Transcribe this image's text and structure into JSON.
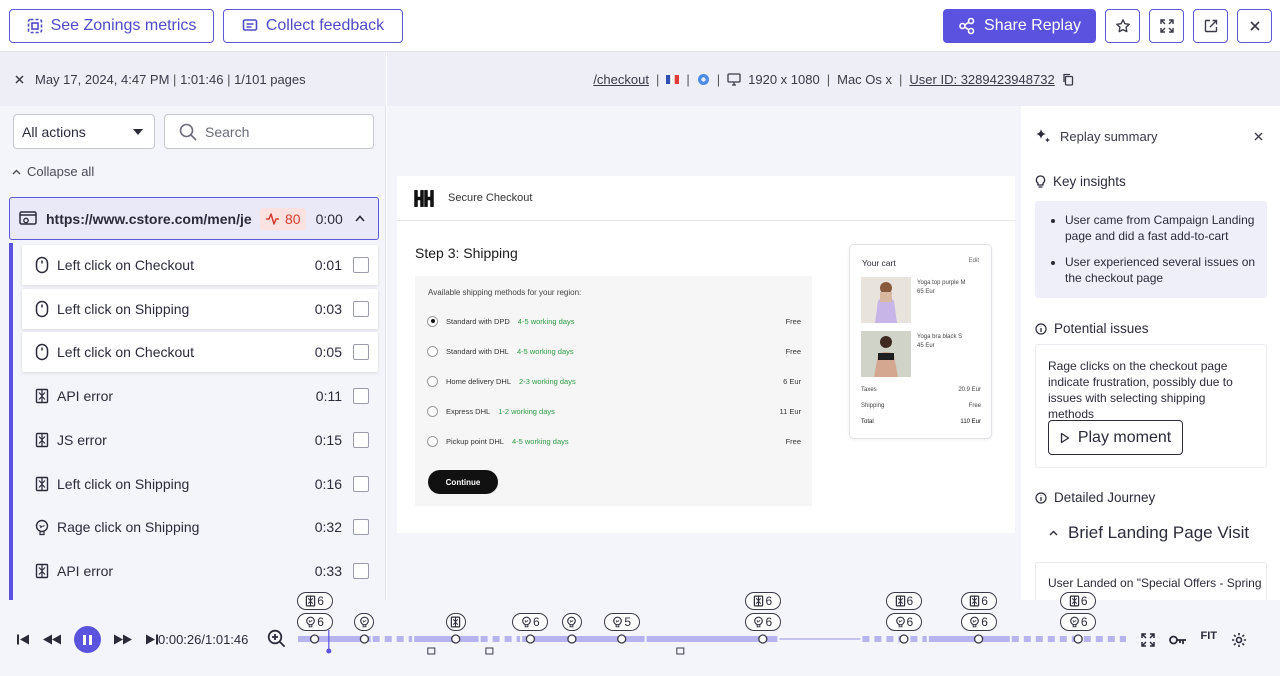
{
  "toolbar": {
    "zonings_label": "See Zonings metrics",
    "feedback_label": "Collect feedback",
    "share_label": "Share Replay"
  },
  "session": {
    "date": "May 17, 2024, 4:47 PM",
    "duration": "1:01:46",
    "pages": "1/101 pages",
    "path": "/checkout",
    "resolution": "1920 x 1080",
    "os": "Mac Os x",
    "user_id": "User ID: 3289423948732"
  },
  "filters": {
    "action_filter": "All actions",
    "search_placeholder": "Search",
    "collapse_label": "Collapse all"
  },
  "page_entry": {
    "url": "https://www.cstore.com/men/je...",
    "error_count": "80",
    "time": "0:00"
  },
  "actions": [
    {
      "icon": "mouse-icon",
      "label": "Left click on Checkout",
      "time": "0:01"
    },
    {
      "icon": "mouse-icon",
      "label": "Left click on Shipping",
      "time": "0:03"
    },
    {
      "icon": "mouse-icon",
      "label": "Left click on Checkout",
      "time": "0:05"
    },
    {
      "icon": "bug-icon",
      "label": "API error",
      "time": "0:11"
    },
    {
      "icon": "bug-icon",
      "label": "JS error",
      "time": "0:15"
    },
    {
      "icon": "bug-icon",
      "label": "Left click on Shipping",
      "time": "0:16"
    },
    {
      "icon": "rage-click-icon",
      "label": "Rage click on Shipping",
      "time": "0:32"
    },
    {
      "icon": "bug-icon",
      "label": "API error",
      "time": "0:33"
    }
  ],
  "replay": {
    "header": "Secure Checkout",
    "step_title": "Step 3: Shipping",
    "methods_hint": "Available shipping methods for your region:",
    "shipping_options": [
      {
        "name": "Standard with DPD",
        "days": "4-5 working days",
        "price": "Free"
      },
      {
        "name": "Standard with DHL",
        "days": "4-5 working days",
        "price": "Free"
      },
      {
        "name": "Home delivery DHL",
        "days": "2-3 working days",
        "price": "6 Eur"
      },
      {
        "name": "Express DHL",
        "days": "1-2 working days",
        "price": "11 Eur"
      },
      {
        "name": "Pickup point DHL",
        "days": "4-5 working days",
        "price": "Free"
      }
    ],
    "selected_option": "Standard with DPD",
    "continue_label": "Continue",
    "cart": {
      "title": "Your cart",
      "edit": "Edit",
      "items": [
        {
          "name": "Yoga top purple M",
          "price": "65 Eur"
        },
        {
          "name": "Yoga bra black S",
          "price": "45 Eur"
        }
      ],
      "taxes_label": "Taxes",
      "taxes_value": "20.9 Eur",
      "shipping_label": "Shipping",
      "shipping_value": "Free",
      "total_label": "Total",
      "total_value": "110 Eur"
    }
  },
  "summary": {
    "title": "Replay summary",
    "insights_title": "Key insights",
    "insights": [
      "User came from Campaign Landing page and did a fast add-to-cart",
      "User experienced several issues on the checkout page"
    ],
    "issues_title": "Potential issues",
    "issues_text": "Rage clicks on the checkout page indicate frustration, possibly due to issues with selecting shipping methods",
    "play_label": "Play moment",
    "journey_title": "Detailed Journey",
    "brief_title": "Brief Landing Page Visit",
    "journey_text": "User Landed on \"Special Offers - Spring"
  },
  "player": {
    "current_time": "0:00:26",
    "total_time": "1:01:46",
    "fit_label": "FIT",
    "progress": 0.007,
    "markers": [
      {
        "type": "bug",
        "count": "6",
        "row": "top",
        "pos": 0.02
      },
      {
        "type": "rage",
        "count": "6",
        "row": "bottom",
        "pos": 0.02
      },
      {
        "type": "rage",
        "count": "",
        "row": "bottom",
        "pos": 0.08
      },
      {
        "type": "bug",
        "count": "",
        "row": "bottom",
        "pos": 0.19
      },
      {
        "type": "rage",
        "count": "6",
        "row": "bottom",
        "pos": 0.28
      },
      {
        "type": "rage",
        "count": "",
        "row": "bottom",
        "pos": 0.33
      },
      {
        "type": "rage",
        "count": "5",
        "row": "bottom",
        "pos": 0.39
      },
      {
        "type": "bug",
        "count": "6",
        "row": "top",
        "pos": 0.56
      },
      {
        "type": "rage",
        "count": "6",
        "row": "bottom",
        "pos": 0.56
      },
      {
        "type": "bug",
        "count": "6",
        "row": "top",
        "pos": 0.73
      },
      {
        "type": "rage",
        "count": "6",
        "row": "bottom",
        "pos": 0.73
      },
      {
        "type": "bug",
        "count": "6",
        "row": "top",
        "pos": 0.82
      },
      {
        "type": "rage",
        "count": "6",
        "row": "bottom",
        "pos": 0.82
      },
      {
        "type": "bug",
        "count": "6",
        "row": "top",
        "pos": 0.94
      },
      {
        "type": "rage",
        "count": "6",
        "row": "bottom",
        "pos": 0.94
      }
    ]
  },
  "colors": {
    "accent": "#5b52e0",
    "error": "#d63b2f",
    "success": "#2e9b45"
  }
}
